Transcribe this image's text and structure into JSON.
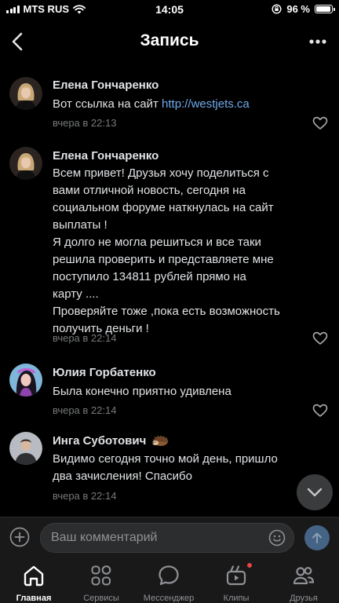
{
  "status_bar": {
    "carrier": "MTS RUS",
    "time": "14:05",
    "battery": "96 %",
    "battery_level": 0.96
  },
  "header": {
    "title": "Запись",
    "back_icon": "chevron-left-icon",
    "more_icon": "more-horizontal-icon"
  },
  "comments": [
    {
      "author": "Елена Гончаренко",
      "text_prefix": "Вот ссылка на сайт ",
      "link": "http://westjets.ca",
      "time": "вчера в 22:13"
    },
    {
      "author": "Елена Гончаренко",
      "lines": [
        "Всем привет! Друзья хочу поделиться с",
        "вами отличной новость, сегодня на",
        "социальном форуме наткнулась на сайт",
        "выплаты !",
        "Я долго не могла решиться и все таки",
        "решила проверить и представляете мне",
        "поступило 134811 рублей прямо на",
        "карту ....",
        "Проверяйте тоже ,пока есть возможность",
        "получить деньги !"
      ],
      "time": "вчера в 22:14"
    },
    {
      "author": "Юлия Горбатенко",
      "text": "Была конечно приятно удивлена",
      "time": "вчера в 22:14"
    },
    {
      "author": "Инга Суботович",
      "lines": [
        "Видимо сегодня точно мой день, пришло",
        "два зачисления! Спасибо"
      ],
      "time": "вчера в 22:14"
    }
  ],
  "input": {
    "placeholder": "Ваш комментарий",
    "value": ""
  },
  "tabs": [
    {
      "label": "Главная",
      "icon": "home-icon",
      "active": true
    },
    {
      "label": "Сервисы",
      "icon": "services-grid-icon",
      "active": false
    },
    {
      "label": "Мессенджер",
      "icon": "messenger-bubble-icon",
      "active": false
    },
    {
      "label": "Клипы",
      "icon": "clips-icon",
      "active": false,
      "badge": true
    },
    {
      "label": "Друзья",
      "icon": "friends-icon",
      "active": false
    }
  ],
  "colors": {
    "background": "#000000",
    "text": "#e1e3e6",
    "secondary": "#76787a",
    "link": "#71aaeb",
    "badge": "#e64646"
  }
}
